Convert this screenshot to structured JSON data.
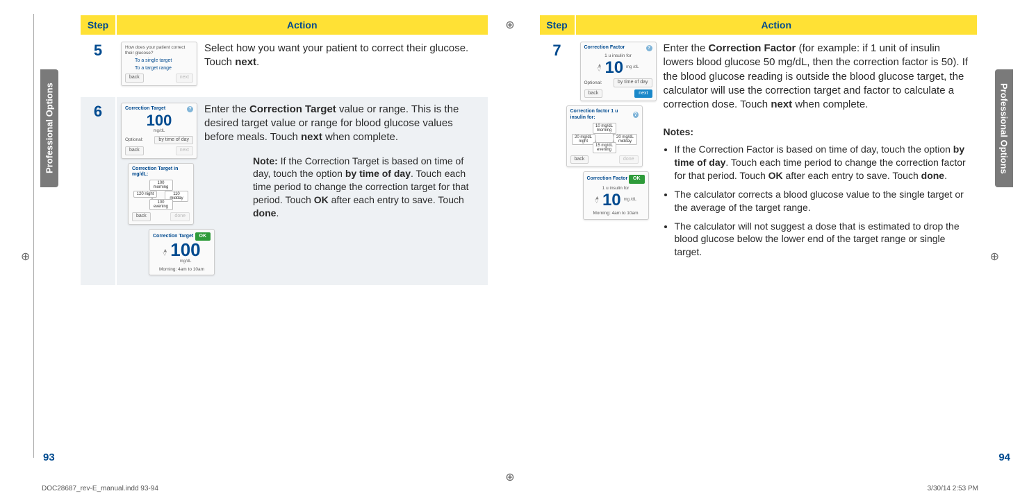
{
  "meta": {
    "doc_file": "DOC28687_rev-E_manual.indd   93-94",
    "print_stamp": "3/30/14   2:53 PM"
  },
  "left": {
    "side_tab": "Professional Options",
    "page_num": "93",
    "header_step": "Step",
    "header_action": "Action",
    "steps": {
      "s5": {
        "num": "5",
        "text_a": "Select how you want your patient to correct their glucose. Touch ",
        "text_b": "next",
        "text_c": ".",
        "mock": {
          "q": "How does your patient correct their glucose?",
          "opt1": "To a single target",
          "opt2": "To a target range",
          "back": "back",
          "next": "next"
        }
      },
      "s6": {
        "num": "6",
        "text_a": "Enter the ",
        "text_b": "Correction Target",
        "text_c": " value or range. This is the desired target value or range for blood glucose values before meals. Touch ",
        "text_d": "next",
        "text_e": " when complete.",
        "note_a": "Note:",
        "note_b": " If the Correction Target is based on time of day, touch the option ",
        "note_c": "by time of day",
        "note_d": ". Touch each time period to change the correction target for that period. Touch ",
        "note_e": "OK",
        "note_f": " after each entry to save. Touch ",
        "note_g": "done",
        "note_h": ".",
        "mock1": {
          "title": "Correction Target",
          "value": "100",
          "unit": "mg/dL",
          "optional": "Optional:",
          "bytime": "by time of day",
          "back": "back",
          "next": "next"
        },
        "mock2": {
          "title": "Correction Target in mg/dL:",
          "pill_top": "100 morning",
          "pill_left": "120 night",
          "pill_right": "110 midday",
          "pill_bot": "100 evening",
          "back": "back",
          "done": "done"
        },
        "mock3": {
          "title": "Correction Target",
          "value": "100",
          "unit": "mg/dL",
          "period": "Morning: 4am to 10am",
          "ok": "OK"
        }
      }
    }
  },
  "right": {
    "side_tab": "Professional Options",
    "page_num": "94",
    "header_step": "Step",
    "header_action": "Action",
    "steps": {
      "s7": {
        "num": "7",
        "text_a": "Enter the ",
        "text_b": "Correction Factor",
        "text_c": " (for example: if 1 unit of insulin lowers blood glucose 50 mg/dL, then the correction factor is 50). If the blood glucose reading is outside the blood glucose target, the calculator will use the correction target and factor to calculate a correction dose. Touch ",
        "text_d": "next",
        "text_e": " when complete.",
        "mock1": {
          "title": "Correction Factor",
          "subtitle": "1 u insulin for",
          "value": "10",
          "unit": "mg /dL",
          "optional": "Optional:",
          "bytime": "by time of day",
          "back": "back",
          "next": "next"
        },
        "mock2": {
          "title": "Correction factor 1 u insulin for:",
          "pill_top": "10 mg/dL morning",
          "pill_left": "20 mg/dL night",
          "pill_right": "20 mg/dL midday",
          "pill_bot": "15 mg/dL evening",
          "back": "back",
          "done": "done"
        },
        "mock3": {
          "title": "Correction Factor",
          "subtitle": "1 u insulin for",
          "value": "10",
          "unit": "mg /dL",
          "period": "Morning: 4am to 10am",
          "ok": "OK"
        },
        "notes_h": "Notes:",
        "note1_a": "If the Correction Factor is based on time of day, touch the option ",
        "note1_b": "by time of day",
        "note1_c": ". Touch each time period to change the correction factor for that period. Touch ",
        "note1_d": "OK",
        "note1_e": " after each entry to save. Touch ",
        "note1_f": "done",
        "note1_g": ".",
        "note2": "The calculator corrects a blood glucose value to the single target or the average of the target range.",
        "note3": "The calculator will not suggest a dose that is estimated to drop the blood glucose below the lower end of the target range or single target."
      }
    }
  }
}
